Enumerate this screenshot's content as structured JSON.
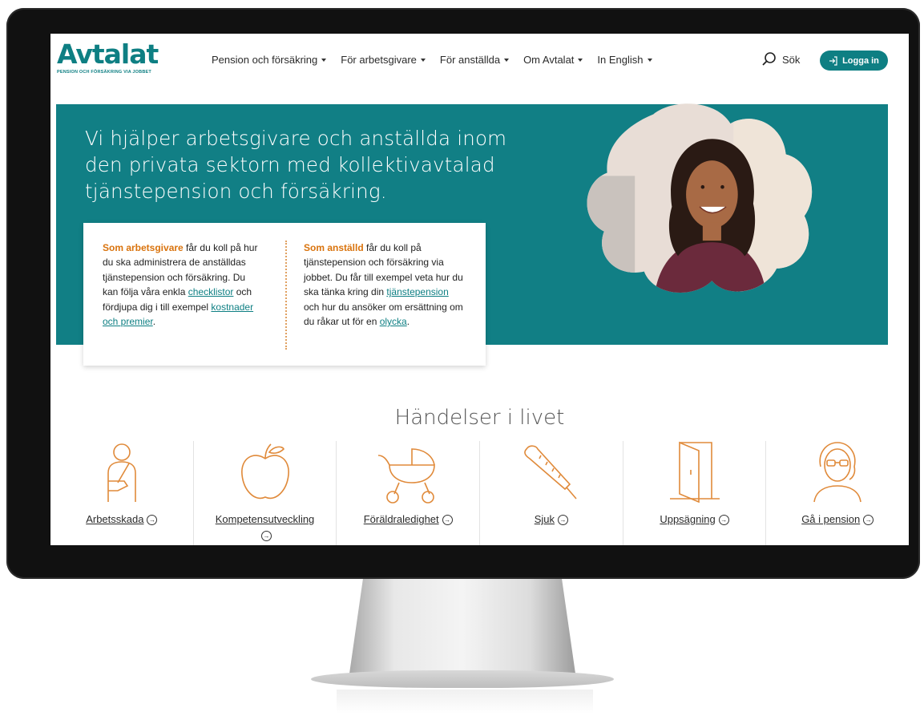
{
  "site": {
    "logo_text": "Avtalat",
    "logo_tagline": "PENSION OCH FÖRSÄKRING VIA JOBBET"
  },
  "nav": {
    "items": [
      {
        "label": "Pension och försäkring"
      },
      {
        "label": "För arbetsgivare"
      },
      {
        "label": "För anställda"
      },
      {
        "label": "Om Avtalat"
      },
      {
        "label": "In English"
      }
    ],
    "search_label": "Sök",
    "login_label": "Logga in"
  },
  "hero": {
    "title": "Vi hjälper arbetsgivare och anställda inom den privata sektorn med kollektivavtalad tjänstepension och försäkring."
  },
  "info": {
    "employer": {
      "highlight": "Som arbetsgivare",
      "text1": " får du koll på hur du ska administrera de anställdas tjänstepension och försäkring. Du kan följa våra enkla ",
      "link1": "checklistor",
      "text2": " och fördjupa dig i till exempel ",
      "link2": "kostnader och premier",
      "text3": "."
    },
    "employee": {
      "highlight": "Som anställd",
      "text1": " får du koll på tjänstepension och försäkring via jobbet. Du får till exempel veta hur du ska tänka kring din ",
      "link1": "tjänstepension",
      "text2": " och hur du ansöker om ersättning om du råkar ut för en ",
      "link2": "olycka",
      "text3": "."
    }
  },
  "events": {
    "title": "Händelser i livet",
    "items": [
      {
        "label": "Arbetsskada",
        "icon": "injured-person-icon"
      },
      {
        "label": "Kompetensutveckling",
        "icon": "apple-icon"
      },
      {
        "label": "Föräldraledighet",
        "icon": "stroller-icon"
      },
      {
        "label": "Sjuk",
        "icon": "thermometer-icon"
      },
      {
        "label": "Uppsägning",
        "icon": "door-icon"
      },
      {
        "label": "Gå i pension",
        "icon": "elderly-person-icon"
      }
    ]
  },
  "colors": {
    "brand": "#0e7f83",
    "accent": "#d9730d",
    "icon": "#e08a3a"
  }
}
